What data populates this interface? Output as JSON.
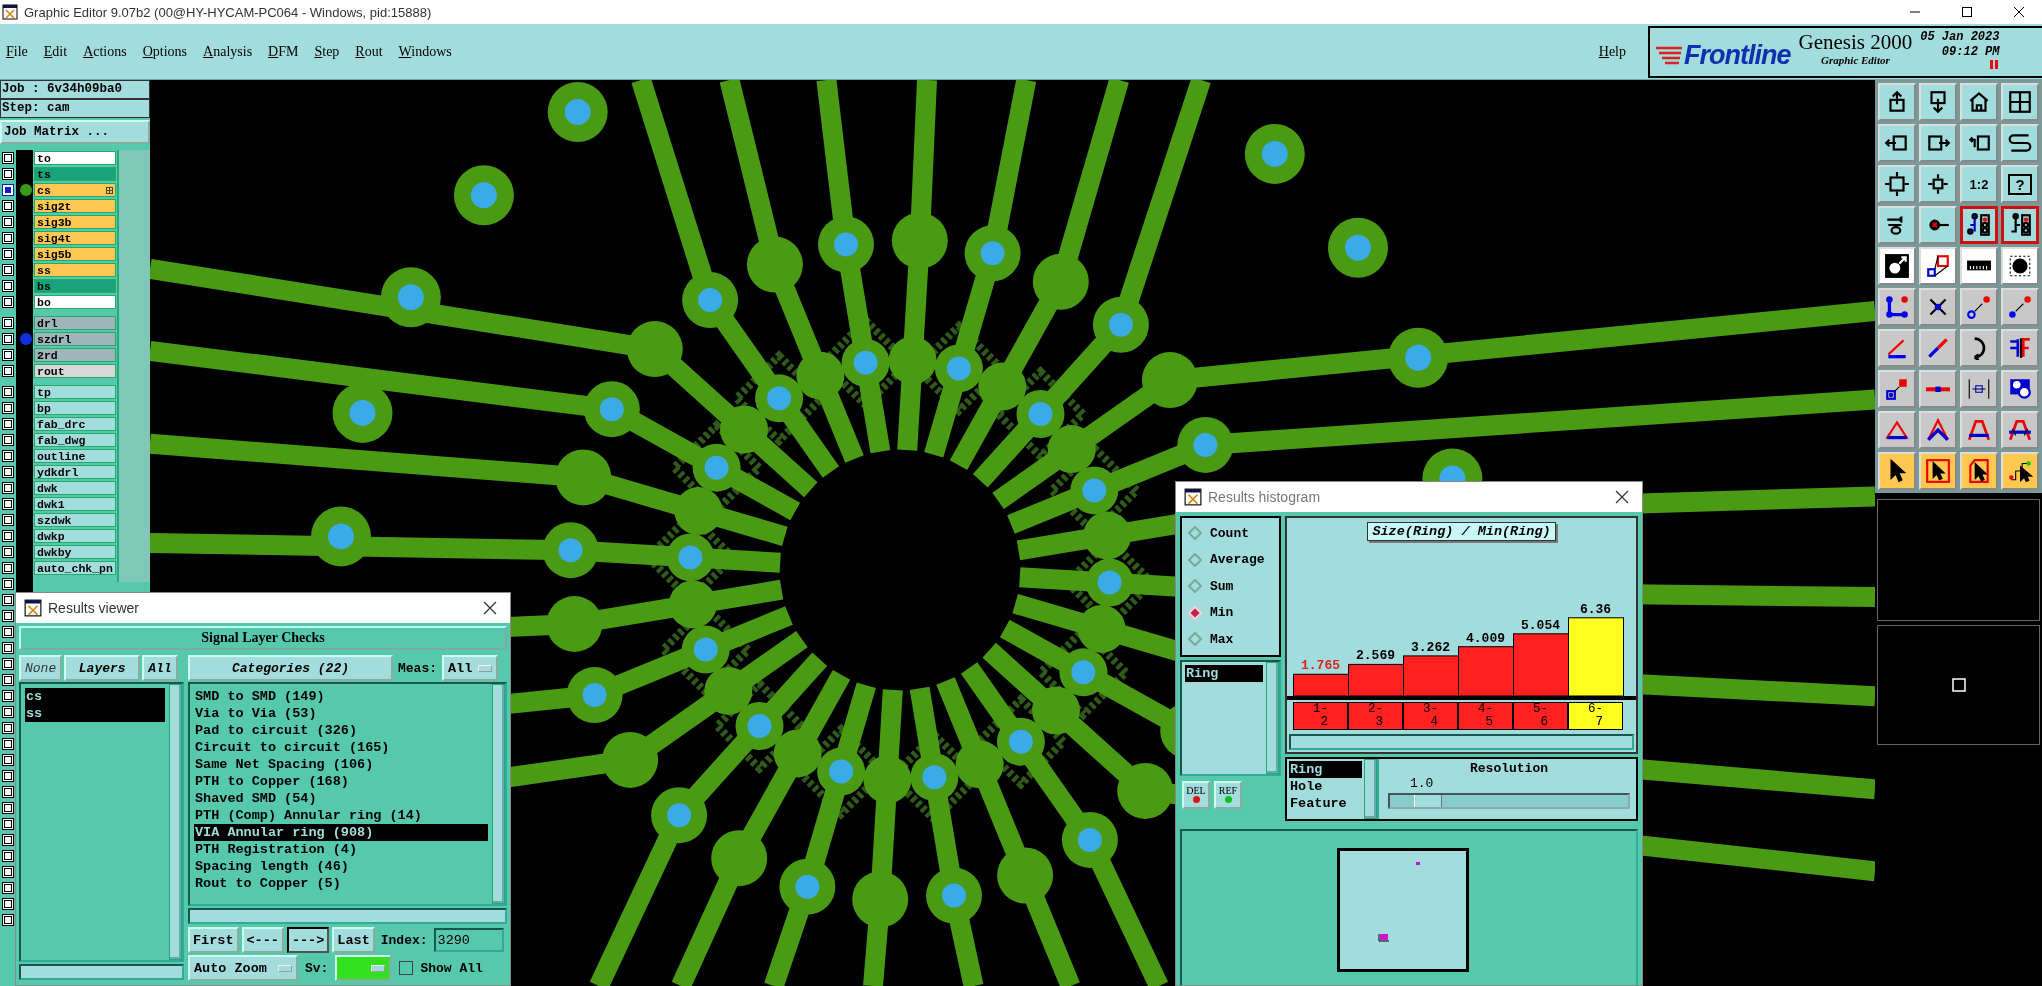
{
  "window": {
    "title": "Graphic Editor 9.07b2 (00@HY-HYCAM-PC064 - Windows, pid:15888)"
  },
  "menu_bar": {
    "items": [
      "File",
      "Edit",
      "Actions",
      "Options",
      "Analysis",
      "DFM",
      "Step",
      "Rout",
      "Windows"
    ],
    "help": "Help"
  },
  "brand": {
    "logo": "Frontline",
    "product": "Genesis 2000",
    "subtitle": "Graphic Editor",
    "date": "05 Jan 2023",
    "time": "09:12 PM"
  },
  "job_panel": {
    "job": "Job : 6v34h09ba0",
    "step": "Step: cam",
    "matrix_button": "Job Matrix ...",
    "layer_groups": [
      {
        "layers": [
          {
            "name": "to",
            "color": "#ffffff",
            "selected": false
          },
          {
            "name": "ts",
            "color": "#1aa37a",
            "selected": false
          },
          {
            "name": "cs",
            "color": "#ffc850",
            "selected": true,
            "dot": {
              "color": "#3a9a1a"
            }
          },
          {
            "name": "sig2t",
            "color": "#ffc850",
            "selected": false
          },
          {
            "name": "sig3b",
            "color": "#ffc850",
            "selected": false
          },
          {
            "name": "sig4t",
            "color": "#ffc850",
            "selected": false
          },
          {
            "name": "sig5b",
            "color": "#ffc850",
            "selected": false
          },
          {
            "name": "ss",
            "color": "#ffc850",
            "selected": false
          },
          {
            "name": "bs",
            "color": "#1aa37a",
            "selected": false
          },
          {
            "name": "bo",
            "color": "#ffffff",
            "selected": false
          }
        ]
      },
      {
        "layers": [
          {
            "name": "drl",
            "color": "#a0b4bc",
            "selected": false
          },
          {
            "name": "szdrl",
            "color": "#a0b4bc",
            "selected": false,
            "dot": {
              "color": "#1030e0"
            }
          },
          {
            "name": "2rd",
            "color": "#a0b4bc",
            "selected": false
          },
          {
            "name": "rout",
            "color": "#d8d8d8",
            "selected": false
          }
        ]
      },
      {
        "layers": [
          {
            "name": "tp",
            "color": "#a3dcdc",
            "selected": false
          },
          {
            "name": "bp",
            "color": "#a3dcdc",
            "selected": false
          },
          {
            "name": "fab_drc",
            "color": "#a3dcdc",
            "selected": false
          },
          {
            "name": "fab_dwg",
            "color": "#a3dcdc",
            "selected": false
          },
          {
            "name": "outline",
            "color": "#a3dcdc",
            "selected": false
          },
          {
            "name": "ydkdrl",
            "color": "#a3dcdc",
            "selected": false
          },
          {
            "name": "dwk",
            "color": "#a3dcdc",
            "selected": false
          },
          {
            "name": "dwk1",
            "color": "#a3dcdc",
            "selected": false
          },
          {
            "name": "szdwk",
            "color": "#a3dcdc",
            "selected": false
          },
          {
            "name": "dwkp",
            "color": "#a3dcdc",
            "selected": false
          },
          {
            "name": "dwkby",
            "color": "#a3dcdc",
            "selected": false
          },
          {
            "name": "auto_chk_pn",
            "color": "#a3dcdc",
            "selected": false
          },
          {
            "selected": false
          },
          {
            "selected": false
          },
          {
            "selected": false
          },
          {
            "selected": false
          },
          {
            "selected": false
          },
          {
            "selected": false
          },
          {
            "selected": false
          },
          {
            "selected": false
          },
          {
            "selected": false
          },
          {
            "selected": false
          },
          {
            "selected": false
          },
          {
            "selected": false
          },
          {
            "selected": false
          },
          {
            "selected": false
          },
          {
            "selected": false
          },
          {
            "selected": false
          },
          {
            "selected": false
          },
          {
            "selected": false
          },
          {
            "selected": false
          },
          {
            "selected": false
          },
          {
            "selected": false
          },
          {
            "selected": false
          }
        ]
      }
    ]
  },
  "toolbar": {
    "buttons": [
      {
        "kind": "view",
        "active": false
      },
      {
        "kind": "view",
        "active": false
      },
      {
        "kind": "view",
        "active": false
      },
      {
        "kind": "view",
        "active": false
      },
      {
        "kind": "view",
        "active": false
      },
      {
        "kind": "view",
        "active": false
      },
      {
        "kind": "view",
        "active": false
      },
      {
        "kind": "view",
        "active": false
      },
      {
        "kind": "view",
        "active": false
      },
      {
        "kind": "view",
        "active": false
      },
      {
        "kind": "view",
        "active": false,
        "label": "1:2"
      },
      {
        "kind": "view",
        "active": false,
        "label": "?"
      },
      {
        "kind": "view",
        "active": false
      },
      {
        "kind": "view",
        "active": false
      },
      {
        "kind": "view",
        "active": true
      },
      {
        "kind": "view",
        "active": true
      },
      {
        "kind": "mode",
        "active": false
      },
      {
        "kind": "mode",
        "active": false
      },
      {
        "kind": "mode",
        "active": false
      },
      {
        "kind": "mode",
        "active": false
      },
      {
        "kind": "edit",
        "active": false
      },
      {
        "kind": "edit",
        "active": false
      },
      {
        "kind": "edit",
        "active": false
      },
      {
        "kind": "edit",
        "active": false
      },
      {
        "kind": "edit",
        "active": false
      },
      {
        "kind": "edit",
        "active": false
      },
      {
        "kind": "edit",
        "active": false
      },
      {
        "kind": "edit",
        "active": false
      },
      {
        "kind": "edit",
        "active": false
      },
      {
        "kind": "edit",
        "active": false
      },
      {
        "kind": "edit",
        "active": false
      },
      {
        "kind": "edit",
        "active": false
      },
      {
        "kind": "edit",
        "active": false
      },
      {
        "kind": "edit",
        "active": false
      },
      {
        "kind": "edit",
        "active": false
      },
      {
        "kind": "edit",
        "active": false
      },
      {
        "kind": "select",
        "active": false
      },
      {
        "kind": "select",
        "active": false
      },
      {
        "kind": "select",
        "active": false
      },
      {
        "kind": "select",
        "active": false
      }
    ]
  },
  "results_viewer": {
    "title": "Results viewer",
    "heading": "Signal Layer Checks",
    "none_button": "None",
    "layers_button": "Layers",
    "all_button": "All",
    "layers": [
      {
        "name": "cs",
        "selected": true
      },
      {
        "name": "ss",
        "selected": true
      }
    ],
    "categories_button": "Categories (22)",
    "meas_label": "Meas:",
    "meas_value": "All",
    "categories": [
      {
        "name": "SMD to SMD (149)",
        "selected": false
      },
      {
        "name": "Via to Via (53)",
        "selected": false
      },
      {
        "name": "Pad to circuit (326)",
        "selected": false
      },
      {
        "name": "Circuit to circuit (165)",
        "selected": false
      },
      {
        "name": "Same Net Spacing (106)",
        "selected": false
      },
      {
        "name": "PTH to Copper (168)",
        "selected": false
      },
      {
        "name": "Shaved SMD (54)",
        "selected": false
      },
      {
        "name": "PTH (Comp) Annular ring (14)",
        "selected": false
      },
      {
        "name": "VIA Annular ring (908)",
        "selected": true
      },
      {
        "name": "PTH Registration (4)",
        "selected": false
      },
      {
        "name": "Spacing length (46)",
        "selected": false
      },
      {
        "name": "Rout to Copper (5)",
        "selected": false
      }
    ],
    "nav_buttons": [
      "First",
      "<---",
      "--->",
      "Last"
    ],
    "index_label": "Index:",
    "index_value": "3290",
    "zoom_mode": "Auto Zoom",
    "sv_label": "Sv:",
    "sv_swatch": {
      "color": "#33e01e"
    },
    "show_all": {
      "label": "Show All",
      "checked": false
    }
  },
  "results_histogram": {
    "title": "Results histogram",
    "modes": [
      {
        "label": "Count",
        "selected": false
      },
      {
        "label": "Average",
        "selected": false
      },
      {
        "label": "Sum",
        "selected": false
      },
      {
        "label": "Min",
        "selected": true
      },
      {
        "label": "Max",
        "selected": false
      }
    ],
    "measures": [
      {
        "name": "Ring",
        "selected": true
      }
    ],
    "del_button": "DEL",
    "ref_button": "REF",
    "chart_data": {
      "type": "bar",
      "title": "Size(Ring) / Min(Ring)",
      "categories": [
        "1-2",
        "2-3",
        "3-4",
        "4-5",
        "5-6",
        "6-7"
      ],
      "series": [
        {
          "values": [
            1.765,
            2.569,
            3.262,
            4.009,
            5.054,
            6.36
          ]
        }
      ],
      "data_labels": true
    },
    "bins": [
      {
        "color": "#ff2020",
        "flagged": true
      },
      {
        "color": "#ff2020",
        "flagged": false
      },
      {
        "color": "#ff2020",
        "flagged": false
      },
      {
        "color": "#ff2020",
        "flagged": false
      },
      {
        "color": "#ff2020",
        "flagged": false
      },
      {
        "color": "#ffff20",
        "flagged": false
      }
    ],
    "fields": [
      {
        "name": "Ring",
        "selected": true
      },
      {
        "name": "Hole",
        "selected": false
      },
      {
        "name": "Feature",
        "selected": false
      }
    ],
    "resolution": {
      "label": "Resolution",
      "value": "1.0",
      "level": 0.1
    }
  }
}
